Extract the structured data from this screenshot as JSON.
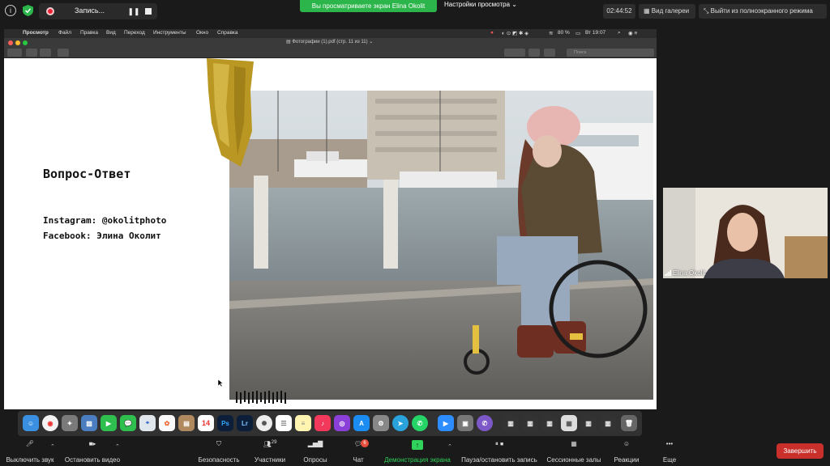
{
  "top": {
    "recording_label": "Запись...",
    "share_banner": "Вы просматриваете экран Elina Okolit",
    "view_settings": "Настройки просмотра",
    "timer": "02:44:52",
    "gallery": "Вид галереи",
    "exit_fullscreen": "Выйти из полноэкранного режима"
  },
  "mac": {
    "menu": [
      "Просмотр",
      "Файл",
      "Правка",
      "Вид",
      "Переход",
      "Инструменты",
      "Окно",
      "Справка"
    ],
    "battery": "80 %",
    "datetime": "Вт 19:07",
    "document_title": "Фотографии (1).pdf (стр. 11 из 11)",
    "search_placeholder": "Поиск"
  },
  "slide": {
    "title": "Вопрос-Ответ",
    "instagram": "Instagram: @okolitphoto",
    "facebook": "Facebook: Элина Околит"
  },
  "participant": {
    "name": "Elina Okolit"
  },
  "controls": {
    "mute": "Выключить звук",
    "video": "Остановить видео",
    "security": "Безопасность",
    "participants": "Участники",
    "participants_count": "29",
    "polls": "Опросы",
    "chat": "Чат",
    "chat_badge": "6",
    "share": "Демонстрация экрана",
    "pause_record": "Пауза/остановить запись",
    "breakout": "Сессионные залы",
    "reactions": "Реакции",
    "more": "Еще",
    "end": "Завершить"
  },
  "colors": {
    "share_green": "#2bb54a",
    "end_red": "#c9302c"
  }
}
